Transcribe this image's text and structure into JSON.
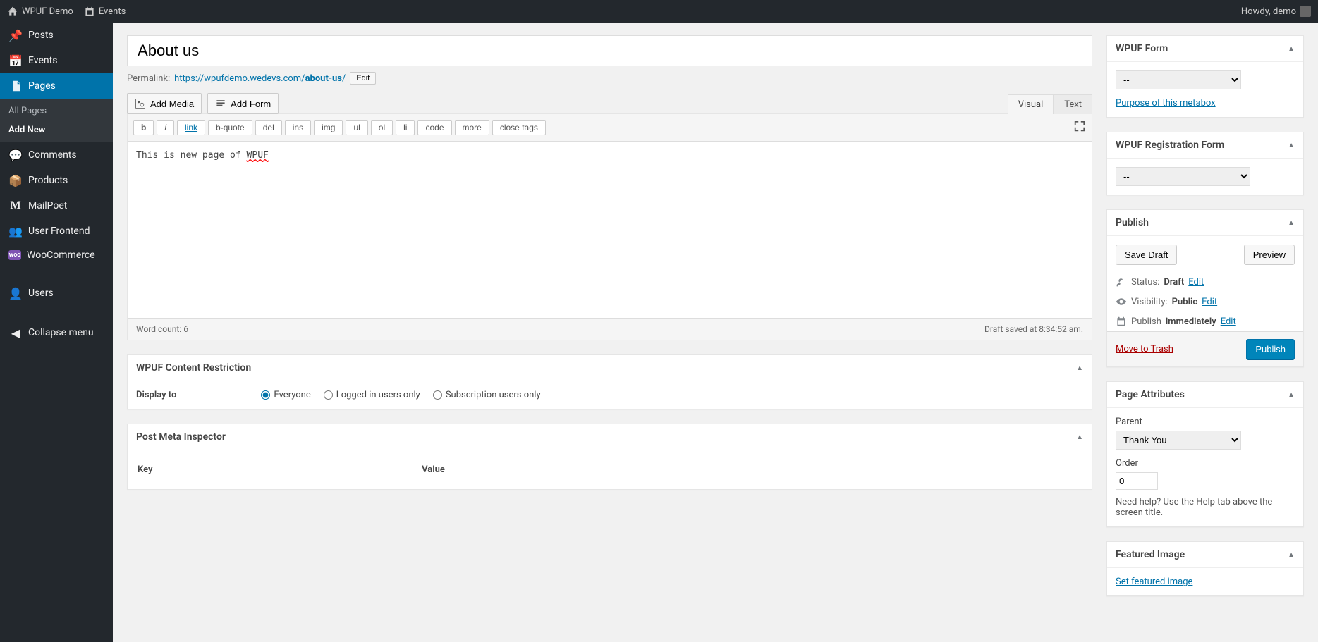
{
  "toolbar": {
    "site_name": "WPUF Demo",
    "events": "Events",
    "howdy": "Howdy, demo"
  },
  "sidebar": {
    "items": [
      {
        "label": "Posts"
      },
      {
        "label": "Events"
      },
      {
        "label": "Pages",
        "active": true
      },
      {
        "label": "Comments"
      },
      {
        "label": "Products"
      },
      {
        "label": "MailPoet"
      },
      {
        "label": "User Frontend"
      },
      {
        "label": "WooCommerce"
      },
      {
        "label": "Users"
      },
      {
        "label": "Collapse menu"
      }
    ],
    "submenu": {
      "all": "All Pages",
      "add": "Add New"
    }
  },
  "editor": {
    "title": "About us",
    "permalink_label": "Permalink:",
    "permalink_url": "https://wpufdemo.wedevs.com/",
    "permalink_slug": "about-us",
    "permalink_trail": "/",
    "edit_btn": "Edit",
    "add_media": "Add Media",
    "add_form": "Add Form",
    "tab_visual": "Visual",
    "tab_text": "Text",
    "quicktags": {
      "b": "b",
      "i": "i",
      "link": "link",
      "bquote": "b-quote",
      "del": "del",
      "ins": "ins",
      "img": "img",
      "ul": "ul",
      "ol": "ol",
      "li": "li",
      "code": "code",
      "more": "more",
      "close": "close tags"
    },
    "content_prefix": "This is new page of ",
    "content_wavy": "WPUF",
    "word_count_label": "Word count: ",
    "word_count": "6",
    "draft_saved": "Draft saved at 8:34:52 am."
  },
  "content_restriction": {
    "title": "WPUF Content Restriction",
    "display_to": "Display to",
    "everyone": "Everyone",
    "logged_in": "Logged in users only",
    "subscription": "Subscription users only"
  },
  "pmi": {
    "title": "Post Meta Inspector",
    "key": "Key",
    "value": "Value"
  },
  "wpuf_form": {
    "title": "WPUF Form",
    "selected": "--",
    "purpose": "Purpose of this metabox"
  },
  "wpuf_reg": {
    "title": "WPUF Registration Form",
    "selected": "--"
  },
  "publish": {
    "title": "Publish",
    "save_draft": "Save Draft",
    "preview": "Preview",
    "status_label": "Status:",
    "status_value": "Draft",
    "visibility_label": "Visibility:",
    "visibility_value": "Public",
    "schedule_label": "Publish",
    "schedule_value": "immediately",
    "edit": "Edit",
    "move_trash": "Move to Trash",
    "publish_btn": "Publish"
  },
  "page_attrs": {
    "title": "Page Attributes",
    "parent_label": "Parent",
    "parent_value": "Thank You",
    "order_label": "Order",
    "order_value": "0",
    "help": "Need help? Use the Help tab above the screen title."
  },
  "featured_image": {
    "title": "Featured Image",
    "set": "Set featured image"
  }
}
